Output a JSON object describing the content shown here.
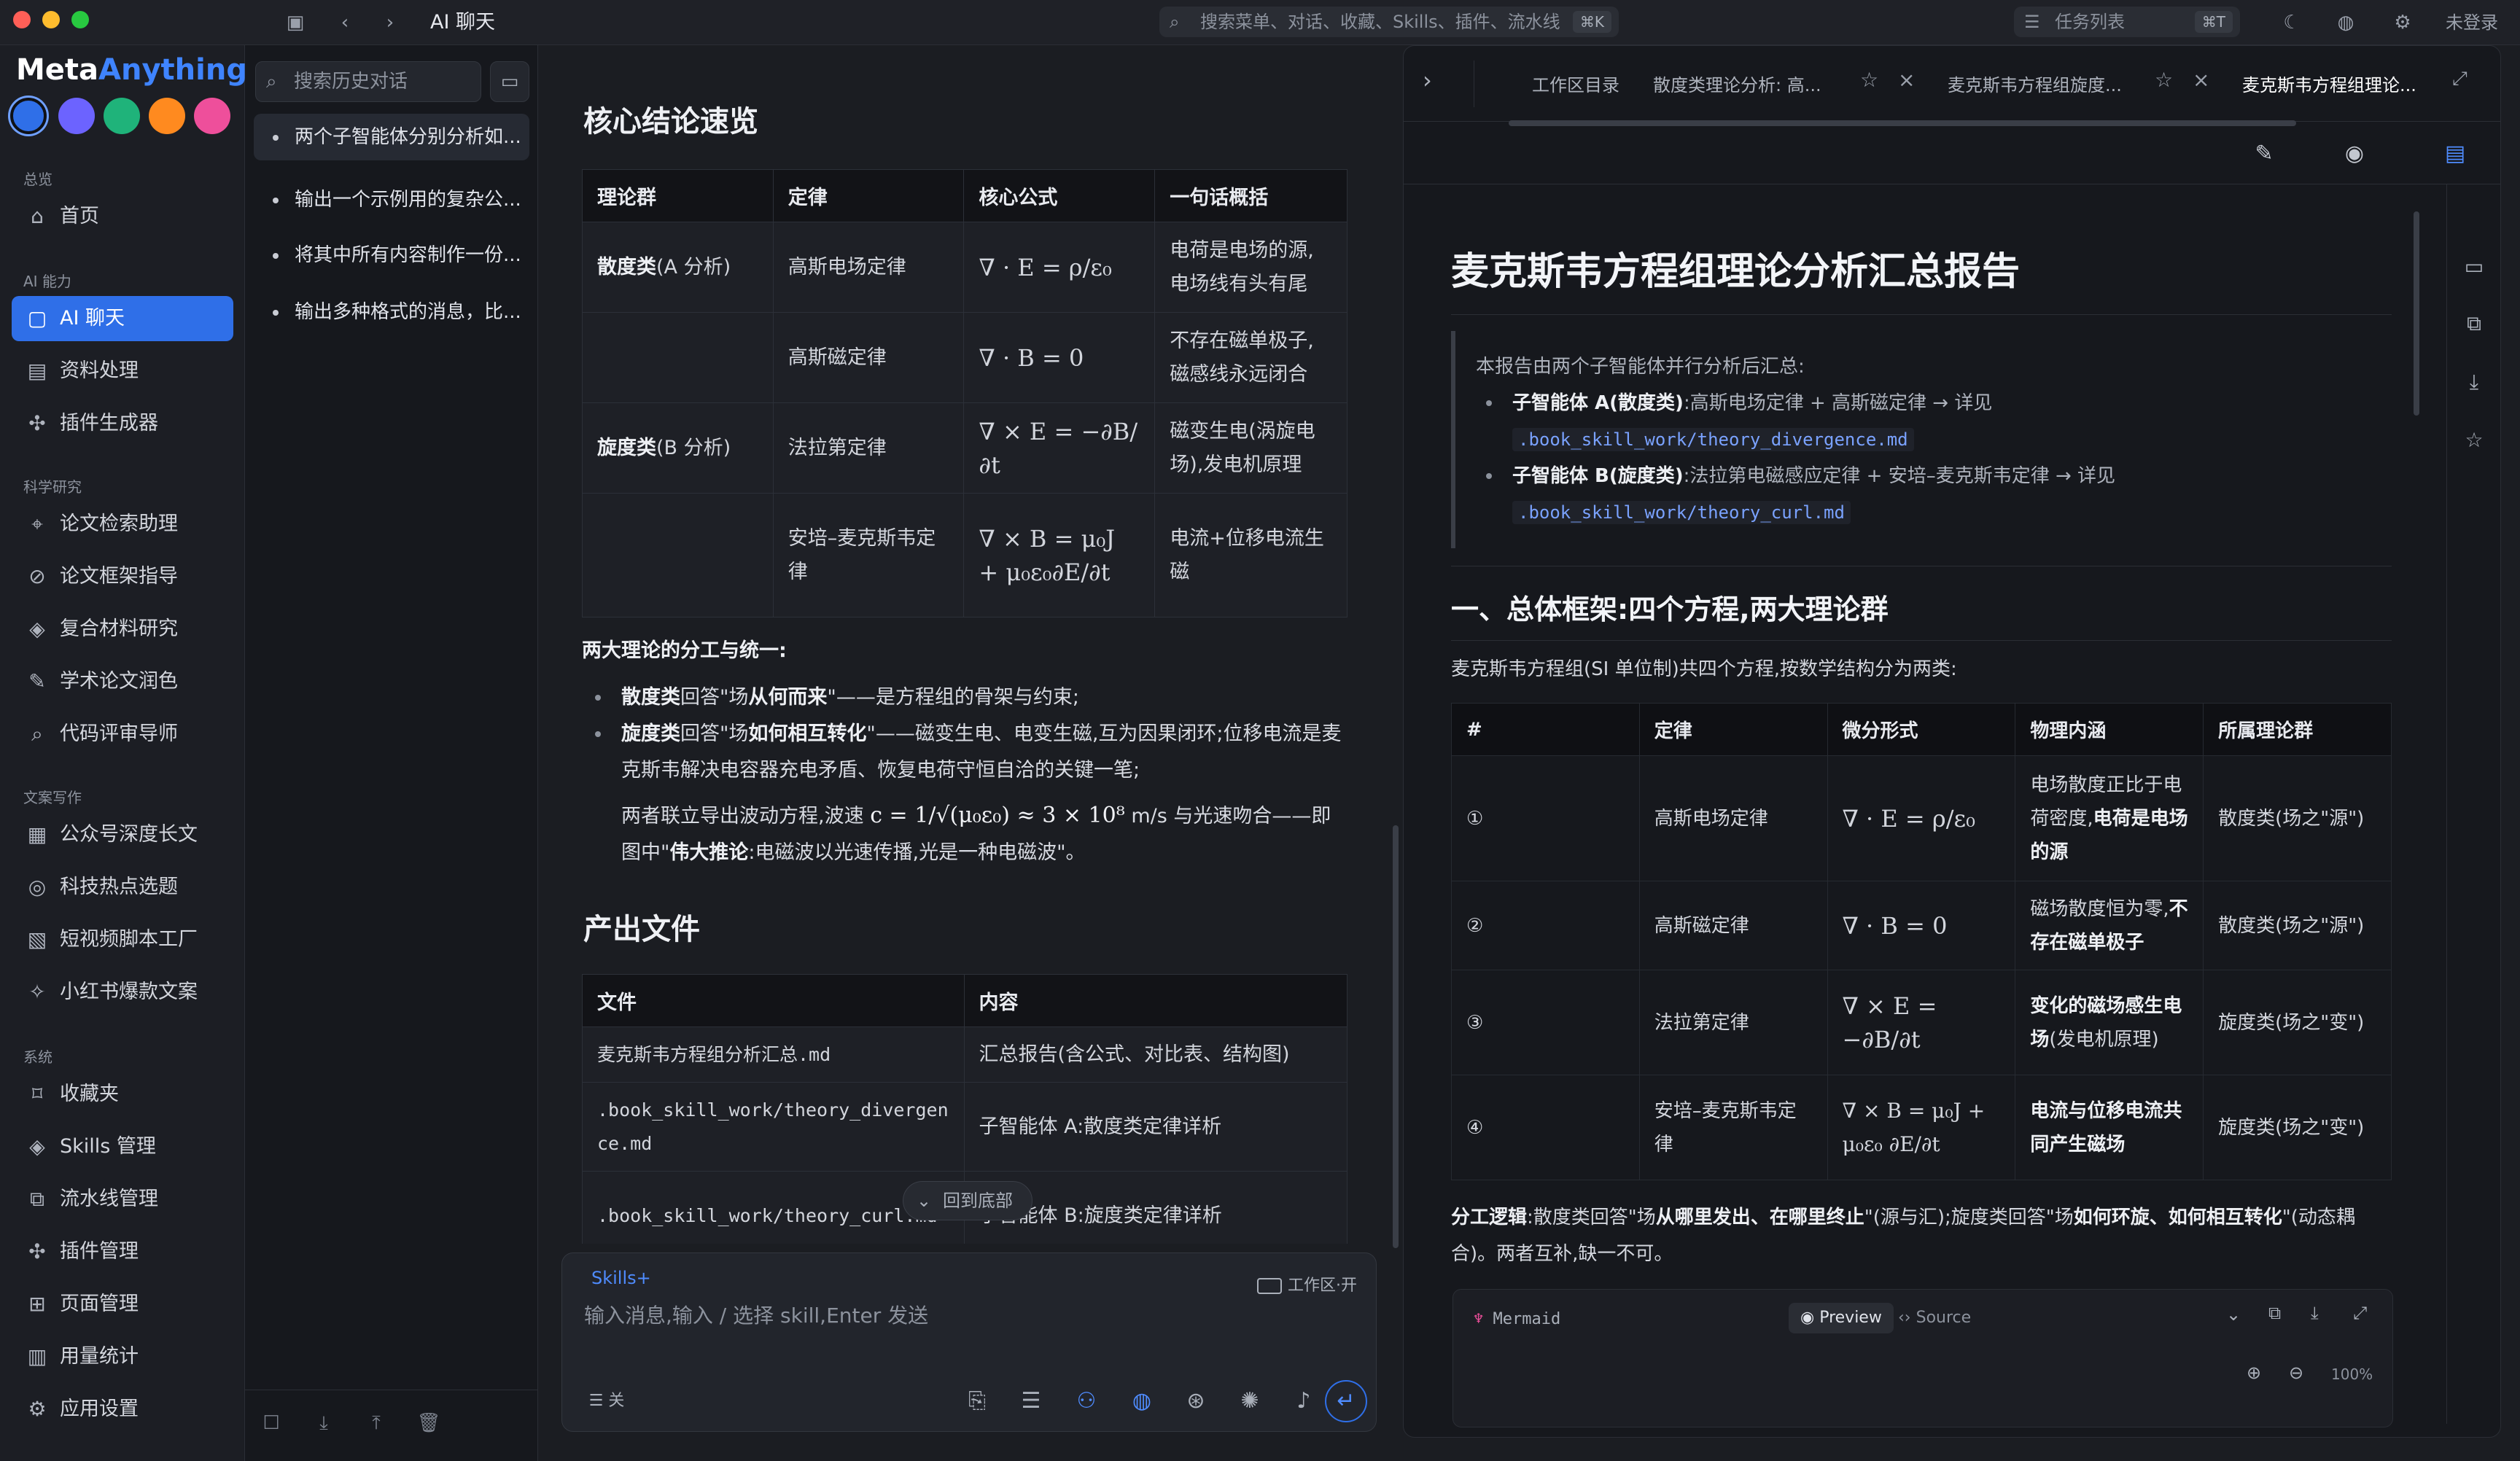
{
  "window": {
    "title": "AI 聊天",
    "search_placeholder": "搜索菜单、对话、收藏、Skills、插件、流水线",
    "search_shortcut": "⌘K",
    "tasks_label": "任务列表",
    "tasks_shortcut": "⌘T",
    "login_label": "未登录"
  },
  "brand": {
    "part1": "Meta",
    "part2": "Anything"
  },
  "colors": {
    "accent": "#2f6fe8",
    "swatches": [
      "#2f6fe8",
      "#6c63ff",
      "#1fb37a",
      "#ff8a1f",
      "#ee4f9b"
    ]
  },
  "sidebar": {
    "sections": [
      {
        "label": "总览",
        "items": [
          {
            "label": "首页",
            "icon": "home-icon"
          }
        ]
      },
      {
        "label": "AI 能力",
        "items": [
          {
            "label": "AI 聊天",
            "icon": "chat-icon",
            "active": true
          },
          {
            "label": "资料处理",
            "icon": "book-icon"
          },
          {
            "label": "插件生成器",
            "icon": "puzzle-icon"
          }
        ]
      },
      {
        "label": "科学研究",
        "items": [
          {
            "label": "论文检索助理",
            "icon": "telescope-icon"
          },
          {
            "label": "论文框架指导",
            "icon": "compass-icon"
          },
          {
            "label": "复合材料研究",
            "icon": "layers-icon"
          },
          {
            "label": "学术论文润色",
            "icon": "pen-icon"
          },
          {
            "label": "代码评审导师",
            "icon": "code-search-icon"
          }
        ]
      },
      {
        "label": "文案写作",
        "items": [
          {
            "label": "公众号深度长文",
            "icon": "article-icon"
          },
          {
            "label": "科技热点选题",
            "icon": "radar-icon"
          },
          {
            "label": "短视频脚本工厂",
            "icon": "clapper-icon"
          },
          {
            "label": "小红书爆款文案",
            "icon": "sparkle-icon"
          }
        ]
      },
      {
        "label": "系统",
        "items": [
          {
            "label": "收藏夹",
            "icon": "bookmark-icon"
          },
          {
            "label": "Skills 管理",
            "icon": "stack-icon"
          },
          {
            "label": "流水线管理",
            "icon": "pipeline-icon"
          },
          {
            "label": "插件管理",
            "icon": "plug-icon"
          },
          {
            "label": "页面管理",
            "icon": "grid-icon"
          },
          {
            "label": "用量统计",
            "icon": "bar-chart-icon"
          },
          {
            "label": "应用设置",
            "icon": "gear-icon"
          }
        ]
      }
    ]
  },
  "history": {
    "search_placeholder": "搜索历史对话",
    "items": [
      {
        "label": "两个子智能体分别分析如...",
        "active": true
      },
      {
        "label": "输出一个示例用的复杂公..."
      },
      {
        "label": "将其中所有内容制作一份..."
      },
      {
        "label": "输出多种格式的消息，比..."
      }
    ]
  },
  "chat": {
    "heading1": "核心结论速览",
    "table1": {
      "headers": [
        "理论群",
        "定律",
        "核心公式",
        "一句话概括"
      ],
      "rows": [
        {
          "group": "散度类",
          "group_note": "(A 分析)",
          "law": "高斯电场定律",
          "formula": "∇ · E = ρ/ε₀",
          "summary": "电荷是电场的源,电场线有头有尾"
        },
        {
          "group": "",
          "group_note": "",
          "law": "高斯磁定律",
          "formula": "∇ · B = 0",
          "summary": "不存在磁单极子,磁感线永远闭合"
        },
        {
          "group": "旋度类",
          "group_note": "(B 分析)",
          "law": "法拉第定律",
          "formula": "∇ × E = −∂B/∂t",
          "summary": "磁变生电(涡旋电场),发电机原理"
        },
        {
          "group": "",
          "group_note": "",
          "law": "安培–麦克斯韦定律",
          "formula": "∇ × B = μ₀J + μ₀ε₀∂E/∂t",
          "summary": "电流+位移电流生磁"
        }
      ]
    },
    "division_title": "两大理论的分工与统一:",
    "bullet1_bold": "散度类",
    "bullet1_mid": "回答\"场",
    "bullet1_bold2": "从何而来",
    "bullet1_tail": "\"——是方程组的骨架与约束;",
    "bullet2_bold": "旋度类",
    "bullet2_mid": "回答\"场",
    "bullet2_bold2": "如何相互转化",
    "bullet2_tail": "\"——磁变生电、电变生磁,互为因果闭环;位移电流是麦克斯韦解决电容器充电矛盾、恢复电荷守恒自洽的关键一笔;",
    "wave_pre": "两者联立导出波动方程,波速",
    "wave_formula": "c = 1/√(μ₀ε₀) ≈ 3 × 10⁸",
    "wave_post": "m/s 与光速吻合——即图中\"",
    "wave_bold": "伟大推论",
    "wave_tail": ":电磁波以光速传播,光是一种电磁波\"。",
    "heading2": "产出文件",
    "table2": {
      "headers": [
        "文件",
        "内容"
      ],
      "rows": [
        {
          "file": "麦克斯韦方程组分析汇总.md",
          "content": "汇总报告(含公式、对比表、结构图)"
        },
        {
          "file": ".book_skill_work/theory_divergence.md",
          "content": "子智能体 A:散度类定律详析"
        },
        {
          "file": ".book_skill_work/theory_curl.md",
          "content": "子智能体 B:旋度类定律详析"
        }
      ]
    },
    "back_to_bottom": "回到底部"
  },
  "composer": {
    "skills_tag": "Skills+",
    "workspace_toggle": "工作区·开",
    "placeholder": "输入消息,输入 / 选择 skill,Enter 发送",
    "tasks_off": "关"
  },
  "panel": {
    "tabs": [
      {
        "label": "工作区目录"
      },
      {
        "label": "散度类理论分析: 高..."
      },
      {
        "label": "麦克斯韦方程组旋度..."
      },
      {
        "label": "麦克斯韦方程组理论...",
        "active": true
      }
    ],
    "doc": {
      "title": "麦克斯韦方程组理论分析汇总报告",
      "intro": "本报告由两个子智能体并行分析后汇总:",
      "agent_a_bold": "子智能体 A(散度类)",
      "agent_a_text": ":高斯电场定律 + 高斯磁定律 → 详见",
      "agent_a_link": ".book_skill_work/theory_divergence.md",
      "agent_b_bold": "子智能体 B(旋度类)",
      "agent_b_text": ":法拉第电磁感应定律 + 安培–麦克斯韦定律 → 详见",
      "agent_b_link": ".book_skill_work/theory_curl.md",
      "section1": "一、总体框架:四个方程,两大理论群",
      "section1_desc": "麦克斯韦方程组(SI 单位制)共四个方程,按数学结构分为两类:",
      "table": {
        "headers": [
          "#",
          "定律",
          "微分形式",
          "物理内涵",
          "所属理论群"
        ],
        "rows": [
          {
            "num": "①",
            "law": "高斯电场定律",
            "formula": "∇ · E = ρ/ε₀",
            "meaning_pre": "电场散度正比于电荷密度,",
            "meaning_bold": "电荷是电场的源",
            "group": "散度类(场之\"源\")"
          },
          {
            "num": "②",
            "law": "高斯磁定律",
            "formula": "∇ · B = 0",
            "meaning_pre": "磁场散度恒为零,",
            "meaning_bold": "不存在磁单极子",
            "group": "散度类(场之\"源\")"
          },
          {
            "num": "③",
            "law": "法拉第定律",
            "formula": "∇ × E = −∂B/∂t",
            "meaning_pre": "",
            "meaning_bold": "变化的磁场感生电场",
            "meaning_post": "(发电机原理)",
            "group": "旋度类(场之\"变\")"
          },
          {
            "num": "④",
            "law": "安培–麦克斯韦定律",
            "formula": "∇ × B = μ₀J + μ₀ε₀ ∂E/∂t",
            "meaning_pre": "",
            "meaning_bold": "电流与位移电流共同产生磁场",
            "group": "旋度类(场之\"变\")"
          }
        ]
      },
      "logic_bold": "分工逻辑",
      "logic_text1": ":散度类回答\"场",
      "logic_bold2": "从哪里发出、在哪里终止",
      "logic_text2": "\"(源与汇);旋度类回答\"场",
      "logic_bold3": "如何环旋、如何相互转化",
      "logic_text3": "\"(动态耦合)。两者互补,缺一不可。",
      "mermaid_label": "Mermaid",
      "preview_label": "Preview",
      "source_label": "Source",
      "zoom": "100%"
    }
  }
}
